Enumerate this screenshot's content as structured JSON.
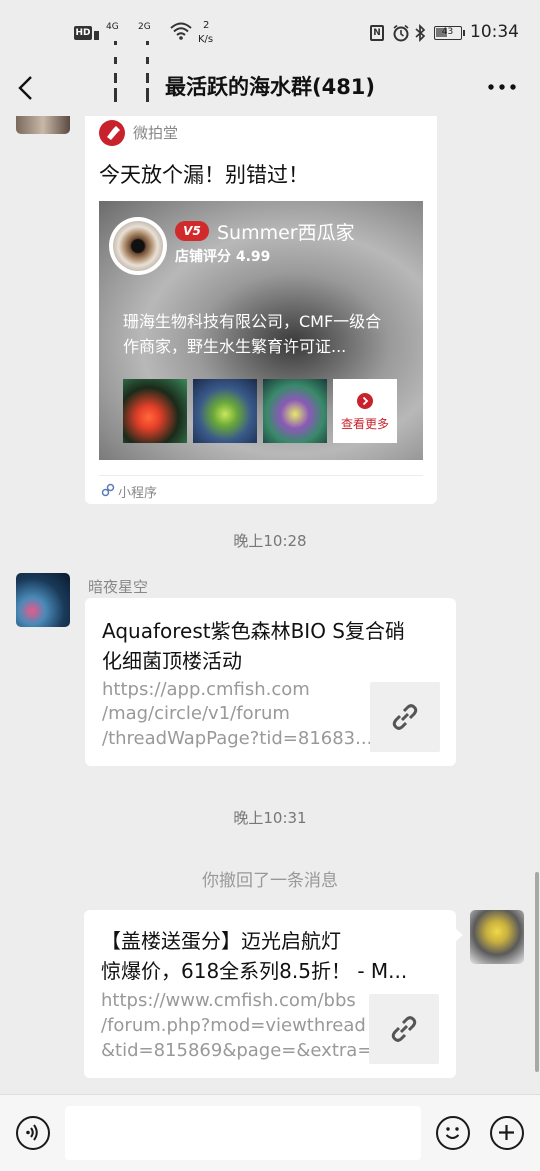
{
  "status": {
    "network_speed_value": "2",
    "network_speed_unit": "K/s",
    "signal1_label": "4G",
    "signal2_label": "2G",
    "battery": "43",
    "time": "10:34"
  },
  "header": {
    "title": "最活跃的海水群(481)"
  },
  "messages": {
    "mini_program": {
      "source_name": "微拍堂",
      "message_title": "今天放个漏！别错过！",
      "level_badge": "V5",
      "shop_name": "Summer西瓜家",
      "shop_rating": "店铺评分 4.99",
      "shop_desc_line1": "珊海生物科技有限公司，CMF一级合",
      "shop_desc_line2": "作商家，野生水生繁育许可证...",
      "view_more": "查看更多",
      "footer_label": "小程序"
    },
    "time1": "晚上10:28",
    "link1": {
      "sender_name": "暗夜星空",
      "title_line1": "Aquaforest紫色森林BIO S复合硝",
      "title_line2": "化细菌顶楼活动",
      "url_line1": "https://app.cmfish.com",
      "url_line2": "/mag/circle/v1/forum",
      "url_line3": "/threadWapPage?tid=81683..."
    },
    "time2": "晚上10:31",
    "recall_notice": "你撤回了一条消息",
    "link2": {
      "title_line1": "【盖楼送蛋分】迈光启航灯",
      "title_line2": "惊爆价，618全系列8.5折！ - M...",
      "url_line1": "https://www.cmfish.com/bbs",
      "url_line2": "/forum.php?mod=viewthread",
      "url_line3": "&tid=815869&page=&extra=..."
    }
  },
  "icons": {
    "back": "back-arrow-icon",
    "more": "more-dots-icon",
    "voice": "voice-icon",
    "emoji": "emoji-icon",
    "plus": "plus-icon",
    "link": "link-icon"
  },
  "colors": {
    "background": "#ededed",
    "card": "#ffffff",
    "weipaitang_red": "#c8232c",
    "muted_text": "#999999"
  }
}
